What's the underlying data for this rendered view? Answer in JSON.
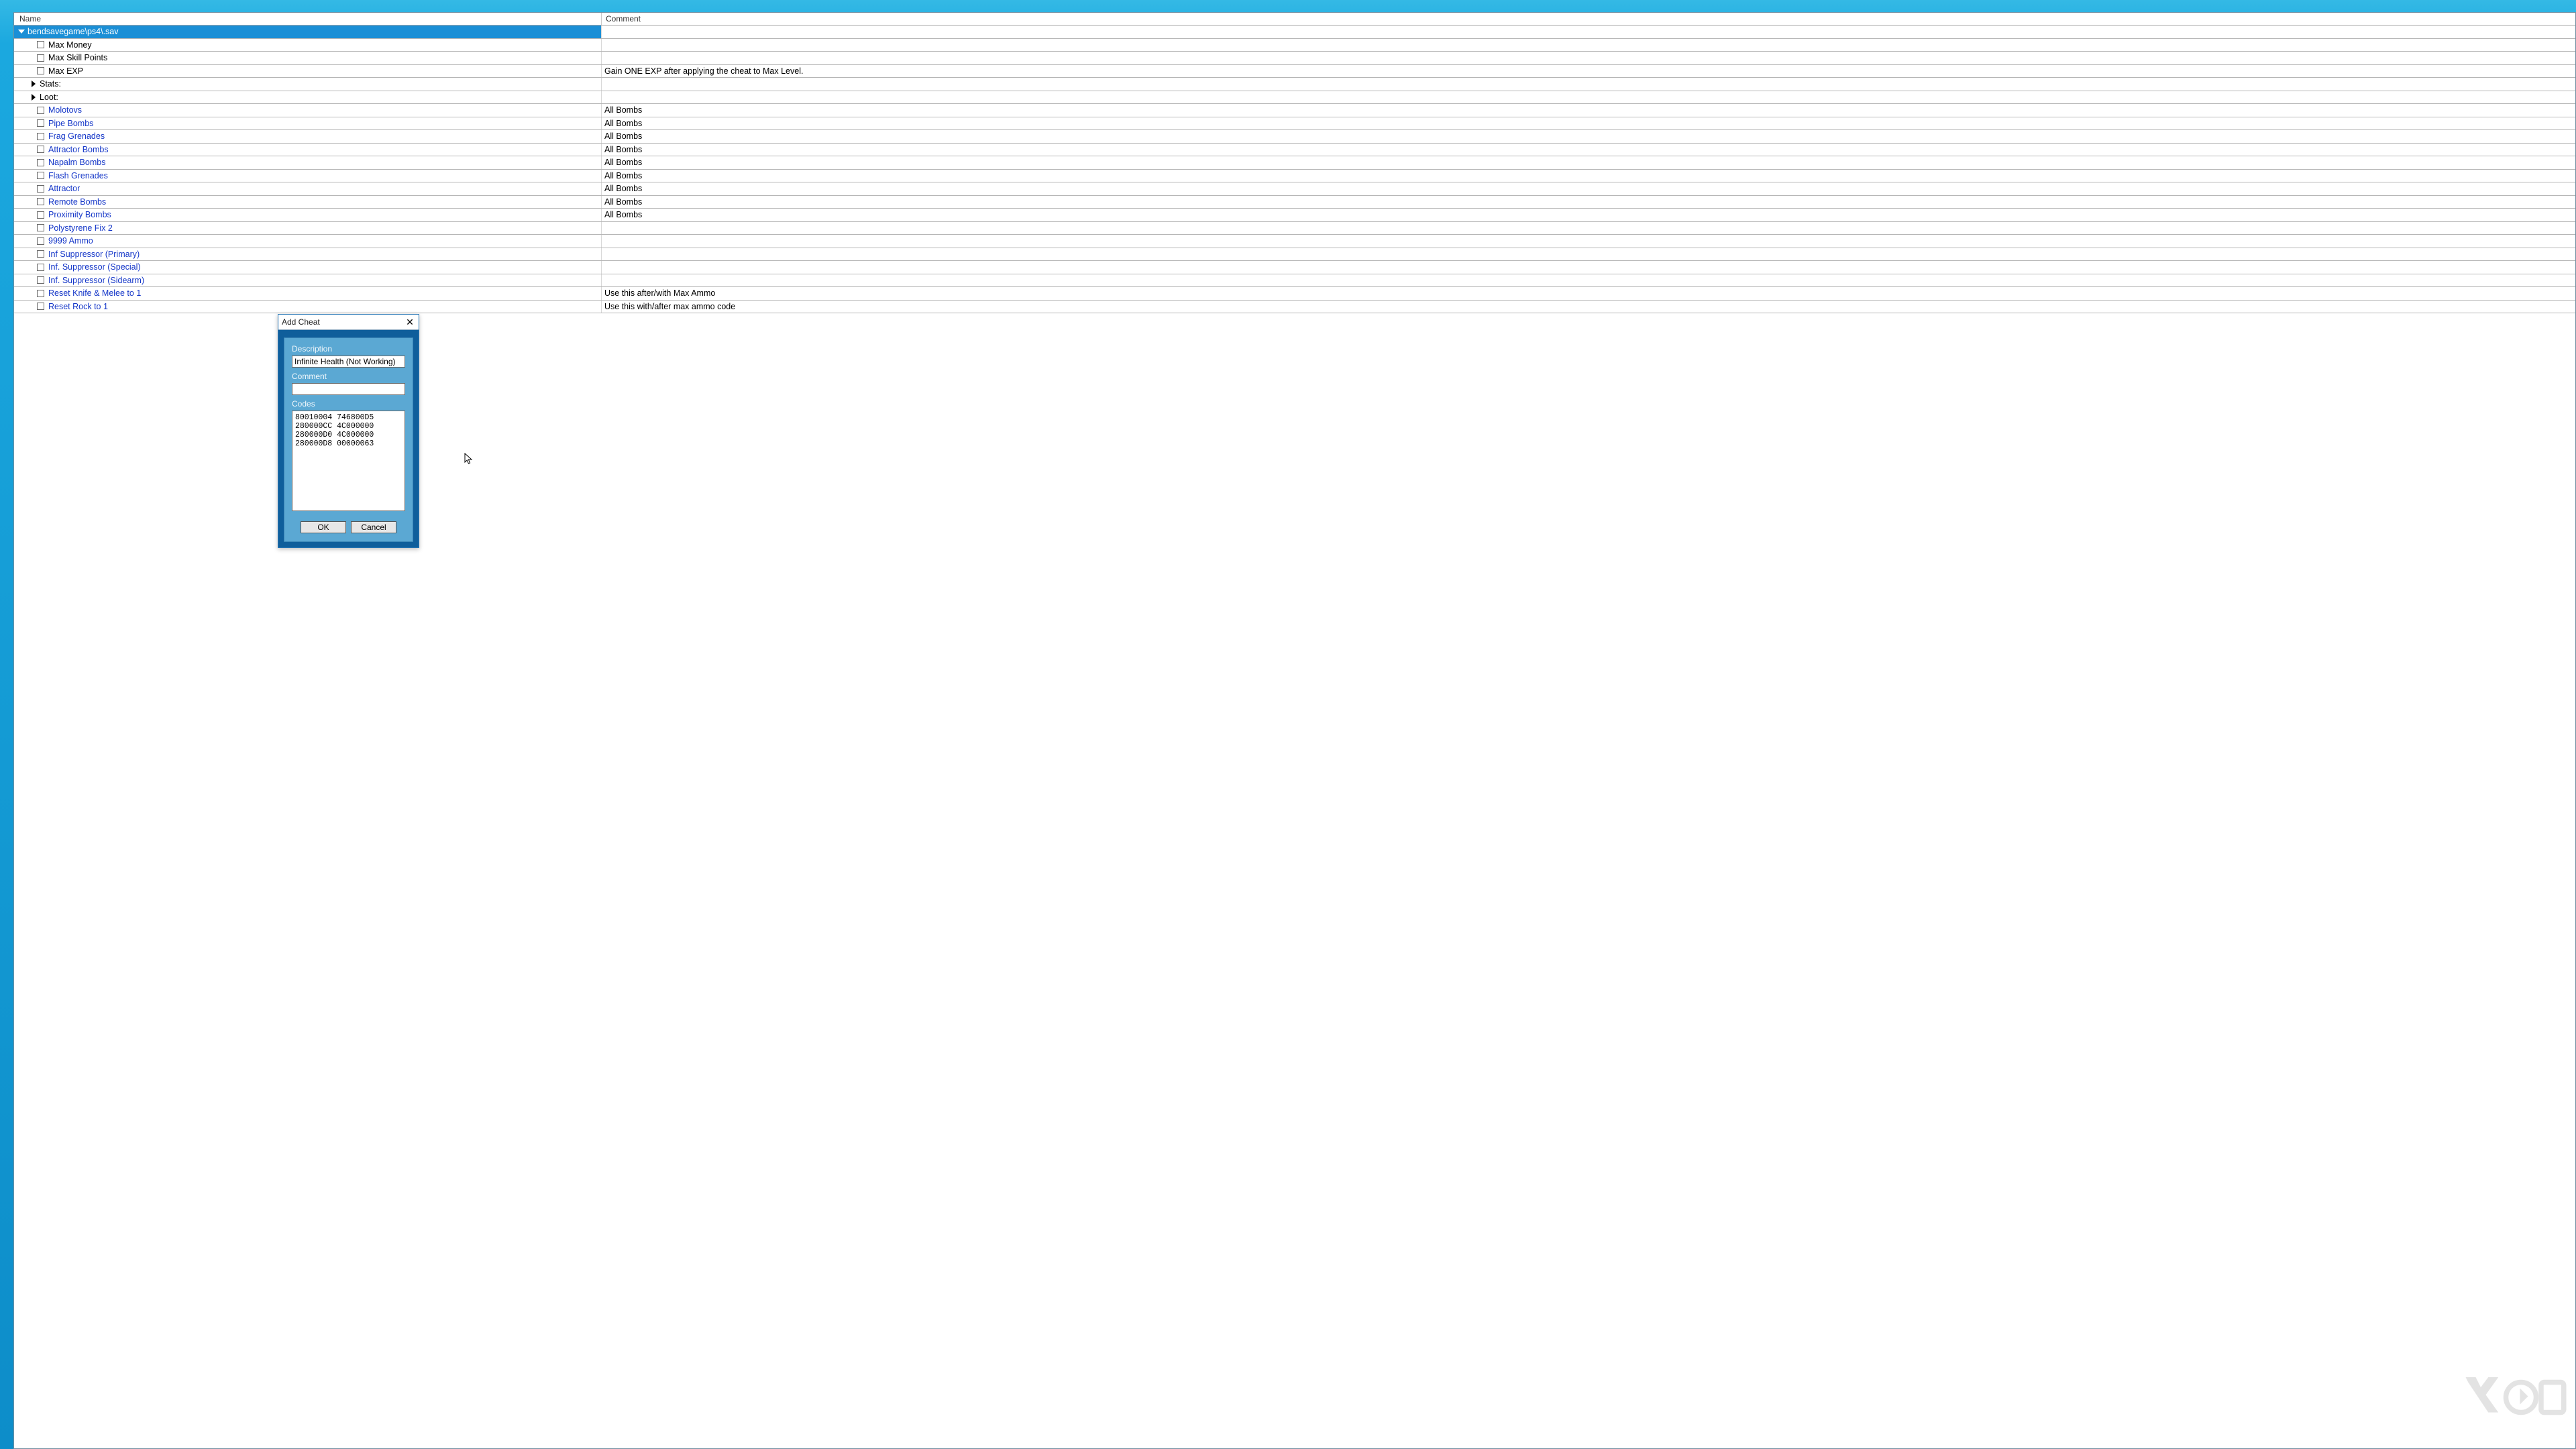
{
  "columns": {
    "name": "Name",
    "comment": "Comment"
  },
  "file_row": {
    "label": "bendsavegame\\ps4\\.sav"
  },
  "rows": [
    {
      "kind": "check",
      "indent": 2,
      "label": "Max Money",
      "link": false,
      "comment": ""
    },
    {
      "kind": "check",
      "indent": 2,
      "label": "Max Skill Points",
      "link": false,
      "comment": ""
    },
    {
      "kind": "check",
      "indent": 2,
      "label": "Max EXP",
      "link": false,
      "comment": "Gain ONE EXP after applying the cheat to Max Level."
    },
    {
      "kind": "group",
      "indent": 1,
      "label": "Stats:",
      "comment": ""
    },
    {
      "kind": "group",
      "indent": 1,
      "label": "Loot:",
      "comment": ""
    },
    {
      "kind": "check",
      "indent": 2,
      "label": "Molotovs",
      "link": true,
      "comment": "All Bombs"
    },
    {
      "kind": "check",
      "indent": 2,
      "label": "Pipe Bombs",
      "link": true,
      "comment": "All Bombs"
    },
    {
      "kind": "check",
      "indent": 2,
      "label": "Frag Grenades",
      "link": true,
      "comment": "All Bombs"
    },
    {
      "kind": "check",
      "indent": 2,
      "label": "Attractor Bombs",
      "link": true,
      "comment": "All Bombs"
    },
    {
      "kind": "check",
      "indent": 2,
      "label": "Napalm Bombs",
      "link": true,
      "comment": "All Bombs"
    },
    {
      "kind": "check",
      "indent": 2,
      "label": "Flash Grenades",
      "link": true,
      "comment": "All Bombs"
    },
    {
      "kind": "check",
      "indent": 2,
      "label": "Attractor",
      "link": true,
      "comment": "All Bombs"
    },
    {
      "kind": "check",
      "indent": 2,
      "label": "Remote Bombs",
      "link": true,
      "comment": "All Bombs"
    },
    {
      "kind": "check",
      "indent": 2,
      "label": "Proximity Bombs",
      "link": true,
      "comment": "All Bombs"
    },
    {
      "kind": "check",
      "indent": 2,
      "label": "Polystyrene Fix 2",
      "link": true,
      "comment": ""
    },
    {
      "kind": "check",
      "indent": 2,
      "label": "9999 Ammo",
      "link": true,
      "comment": ""
    },
    {
      "kind": "check",
      "indent": 2,
      "label": "Inf Suppressor (Primary)",
      "link": true,
      "comment": ""
    },
    {
      "kind": "check",
      "indent": 2,
      "label": "Inf. Suppressor (Special)",
      "link": true,
      "comment": ""
    },
    {
      "kind": "check",
      "indent": 2,
      "label": "Inf. Suppressor (Sidearm)",
      "link": true,
      "comment": ""
    },
    {
      "kind": "check",
      "indent": 2,
      "label": "Reset Knife & Melee to 1",
      "link": true,
      "comment": "Use this after/with Max Ammo"
    },
    {
      "kind": "check",
      "indent": 2,
      "label": "Reset Rock to 1",
      "link": true,
      "comment": "Use this with/after max ammo code"
    }
  ],
  "dialog": {
    "title": "Add Cheat",
    "labels": {
      "description": "Description",
      "comment": "Comment",
      "codes": "Codes"
    },
    "description_value": "Infinite Health (Not Working)",
    "comment_value": "",
    "codes_value": "80010004 746800D5\n280000CC 4C000000\n280000D0 4C000000\n280000D8 00000063",
    "buttons": {
      "ok": "OK",
      "cancel": "Cancel"
    }
  }
}
